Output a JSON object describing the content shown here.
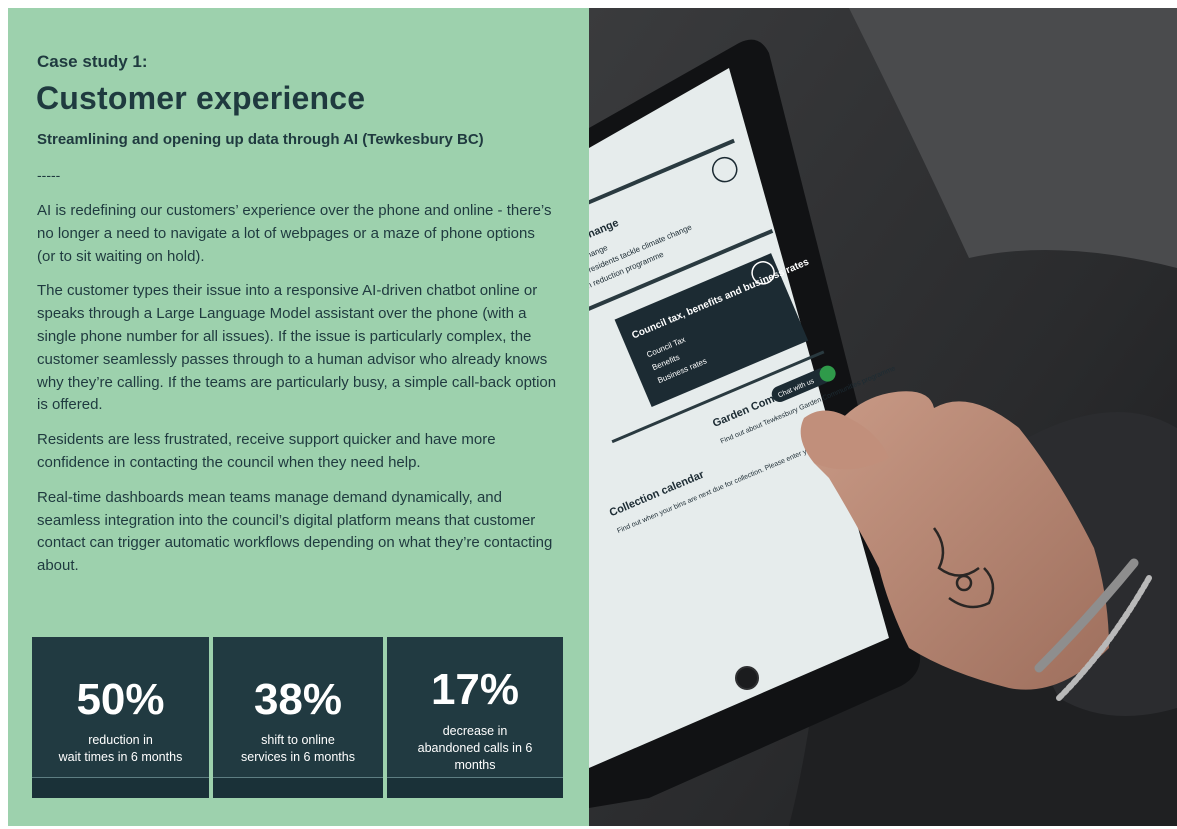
{
  "case_study": {
    "kicker": "Case study 1:",
    "title": "Customer experience",
    "subtitle": "Streamlining and opening up data through AI (Tewkesbury BC)",
    "divider": "-----",
    "paragraphs": [
      "AI is redefining our customers’ experience over the phone and online - there’s no longer a need to navigate a lot of webpages or a maze of phone options (or to sit waiting on hold).",
      "The customer types their issue into a responsive AI-driven chatbot online or speaks through a Large Language Model assistant over the phone (with a single phone number for all issues). If the issue is particularly complex, the customer seamlessly passes through to a human advisor who already knows why they’re calling. If the teams are particularly busy, a simple call-back option is offered.",
      "Residents are less frustrated, receive support quicker and have more confidence in contacting the council when they need help.",
      "Real-time dashboards mean teams manage demand dynamically, and seamless integration into the council’s digital platform means that customer contact can trigger automatic workflows depending on what they’re contacting about."
    ]
  },
  "stats": [
    {
      "value": "50%",
      "label_line1": "reduction in",
      "label_line2": "wait times in 6 months",
      "label_line3": ""
    },
    {
      "value": "38%",
      "label_line1": "shift to online",
      "label_line2": "services in 6 months",
      "label_line3": ""
    },
    {
      "value": "17%",
      "label_line1": "decrease in",
      "label_line2": "abandoned calls in 6",
      "label_line3": "months"
    }
  ],
  "photo": {
    "description_labels": {
      "tile_1": "Climate change",
      "tile_1_items": [
        "Climate change",
        "Helping residents tackle climate change",
        "Carbon reduction programme"
      ],
      "tile_2": "Council tax, benefits and business rates",
      "tile_2_items": [
        "Council Tax",
        "Benefits",
        "Business rates"
      ],
      "tile_3": "Garden Communities",
      "tile_3_text": "Find out about Tewkesbury Garden Communities programme",
      "tile_4": "Collection calendar",
      "tile_4_text": "Find out when your bins are next due for collection. Please enter your postcode",
      "chat_button": "Chat with us"
    },
    "colors": {
      "background": "#2d2e30",
      "tablet": "#111214",
      "screen": "#e6ecec",
      "dark_tile": "#1c2b33"
    }
  },
  "colors": {
    "panel": "#9dd1ad",
    "ink": "#1f3a3f",
    "stat_box": "#213a41"
  }
}
